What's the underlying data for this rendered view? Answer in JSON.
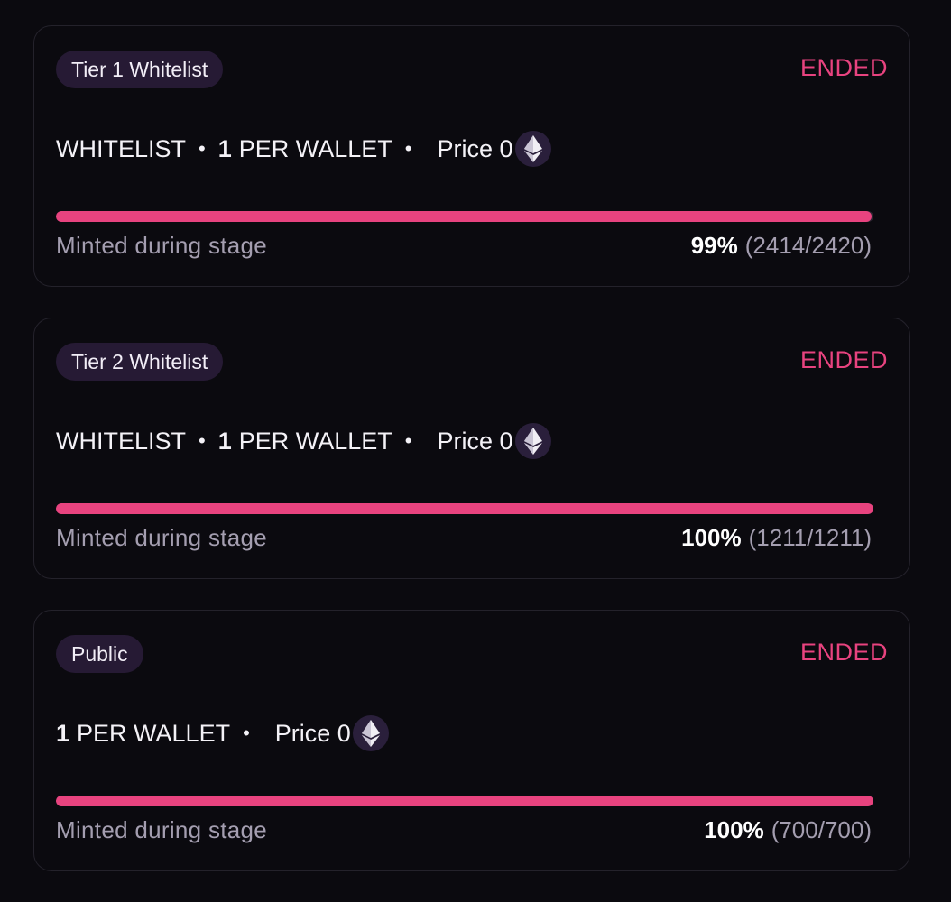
{
  "accent_color": "#e8437f",
  "stages": [
    {
      "name": "Tier 1 Whitelist",
      "status": "ENDED",
      "type": "WHITELIST",
      "per_wallet_qty": "1",
      "per_wallet_label": "PER WALLET",
      "price_label": "Price 0",
      "currency_icon": "ethereum-icon",
      "minted_label": "Minted during stage",
      "minted_percent": "99%",
      "minted_count": "(2414/2420)",
      "progress_fraction": 0.9975
    },
    {
      "name": "Tier 2 Whitelist",
      "status": "ENDED",
      "type": "WHITELIST",
      "per_wallet_qty": "1",
      "per_wallet_label": "PER WALLET",
      "price_label": "Price 0",
      "currency_icon": "ethereum-icon",
      "minted_label": "Minted during stage",
      "minted_percent": "100%",
      "minted_count": "(1211/1211)",
      "progress_fraction": 1.0
    },
    {
      "name": "Public",
      "status": "ENDED",
      "type": "",
      "per_wallet_qty": "1",
      "per_wallet_label": "PER WALLET",
      "price_label": "Price 0",
      "currency_icon": "ethereum-icon",
      "minted_label": "Minted during stage",
      "minted_percent": "100%",
      "minted_count": "(700/700)",
      "progress_fraction": 1.0
    }
  ]
}
